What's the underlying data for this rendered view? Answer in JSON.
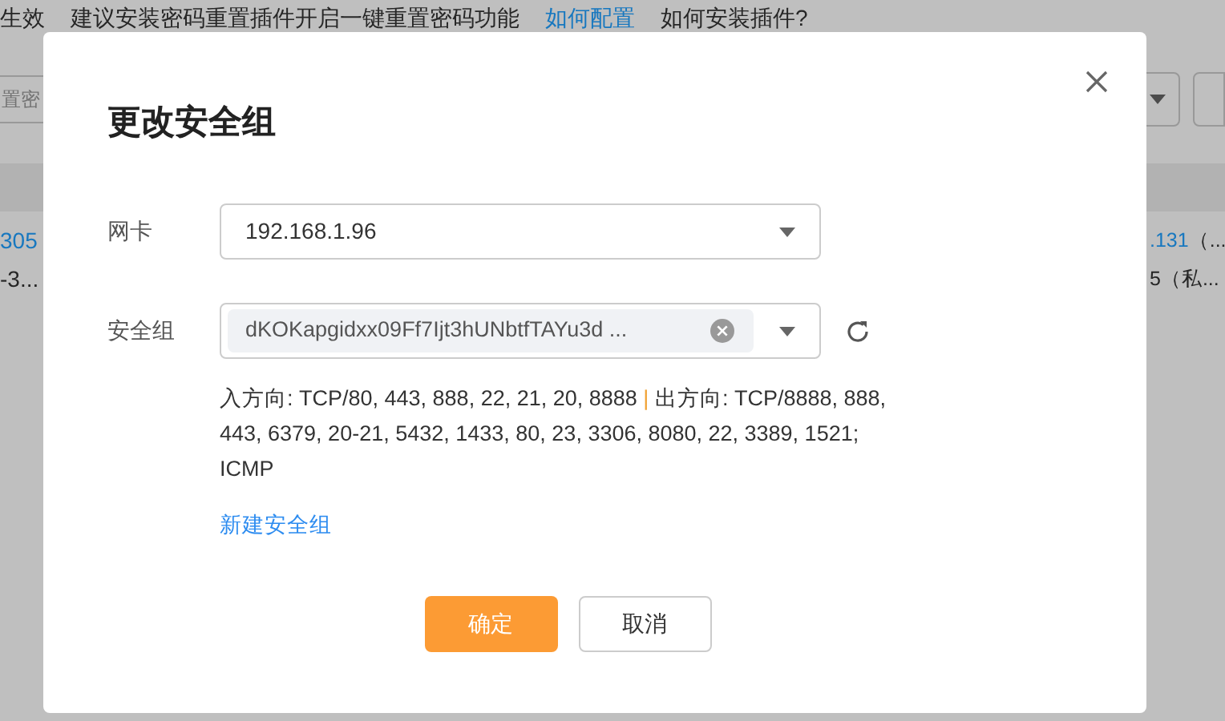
{
  "background": {
    "notice": {
      "status": "生效",
      "text": "建议安装密码重置插件开启一键重置密码功能",
      "link": "如何配置",
      "help": "如何安装插件?"
    },
    "search": {
      "placeholder": "置密"
    },
    "row": {
      "left_id": "305",
      "left_sub": "-3...",
      "right_ip": ".131",
      "right_ip_note": "（...",
      "right_sub": "5",
      "right_sub_note": "（私..."
    }
  },
  "dialog": {
    "title": "更改安全组",
    "nic": {
      "label": "网卡",
      "value": "192.168.1.96"
    },
    "security_group": {
      "label": "安全组",
      "tags": [
        "dKOKapgidxx09Ff7Ijt3hUNbtfTAYu3d ..."
      ]
    },
    "rules": {
      "inbound": "入方向: TCP/80, 443, 888, 22, 21, 20, 8888",
      "separator": "|",
      "outbound": "出方向: TCP/8888, 888, 443, 6379, 20-21, 5432, 1433, 80, 23, 3306, 8080, 22, 3389, 1521; ICMP"
    },
    "create_link": "新建安全组",
    "buttons": [
      {
        "label": "确定",
        "kind": "primary"
      },
      {
        "label": "取消",
        "kind": "default"
      }
    ]
  }
}
